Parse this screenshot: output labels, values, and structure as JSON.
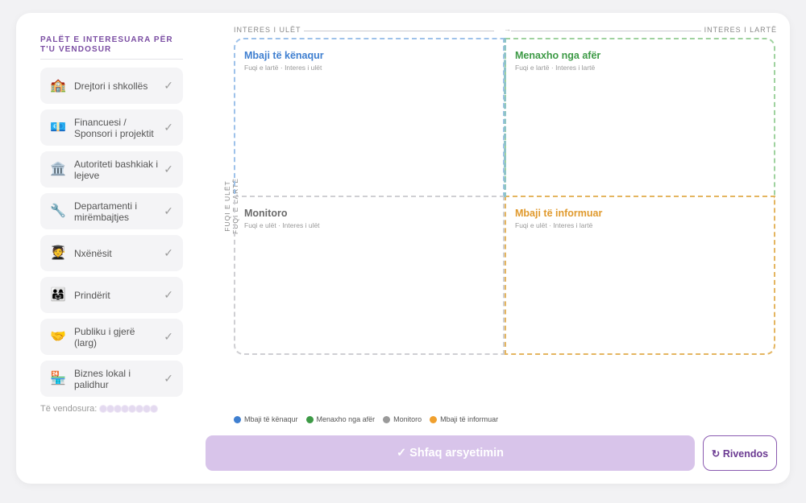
{
  "sidebar": {
    "title": "PALËT E INTERESUARA PËR T'U VENDOSUR",
    "items": [
      {
        "icon": "🏫",
        "icon_name": "school-icon",
        "label": "Drejtori i shkollës",
        "check": "✓"
      },
      {
        "icon": "💶",
        "icon_name": "money-icon",
        "label": "Financuesi / Sponsori i projektit",
        "check": "✓"
      },
      {
        "icon": "🏛️",
        "icon_name": "government-building-icon",
        "label": "Autoriteti bashkiak i lejeve",
        "check": "✓"
      },
      {
        "icon": "🔧",
        "icon_name": "wrench-icon",
        "label": "Departamenti i mirëmbajtjes",
        "check": "✓"
      },
      {
        "icon": "🧑‍🎓",
        "icon_name": "student-icon",
        "label": "Nxënësit",
        "check": "✓"
      },
      {
        "icon": "👨‍👩‍👧",
        "icon_name": "family-icon",
        "label": "Prindërit",
        "check": "✓"
      },
      {
        "icon": "🤝",
        "icon_name": "handshake-icon",
        "label": "Publiku i gjerë (larg)",
        "check": "✓"
      },
      {
        "icon": "🏪",
        "icon_name": "store-icon",
        "label": "Biznes lokal i palidhur",
        "check": "✓"
      }
    ],
    "decided_label": "Të vendosura:",
    "decided_count": 8
  },
  "axes": {
    "x_low": "INTERES I ULËT",
    "x_high": "INTERES I LARTË",
    "y_low": "FUQI E ULËT",
    "y_high": "FUQI E LARTË",
    "arrow": "→"
  },
  "quadrants": {
    "top_left": {
      "title": "Mbaji të kënaqur",
      "subtitle": "Fuqi e lartë · Interes i ulët",
      "color": "#3f7fd0"
    },
    "top_right": {
      "title": "Menaxho nga afër",
      "subtitle": "Fuqi e lartë · Interes i lartë",
      "color": "#3d9a46"
    },
    "bottom_left": {
      "title": "Monitoro",
      "subtitle": "Fuqi e ulët · Interes i ulët",
      "color": "#6a6a6a"
    },
    "bottom_right": {
      "title": "Mbaji të informuar",
      "subtitle": "Fuqi e ulët · Interes i lartë",
      "color": "#e09a2e"
    }
  },
  "legend": [
    {
      "label": "Mbaji të kënaqur",
      "color": "#3f7fd0"
    },
    {
      "label": "Menaxho nga afër",
      "color": "#3d9a46"
    },
    {
      "label": "Monitoro",
      "color": "#9a9a9a"
    },
    {
      "label": "Mbaji të informuar",
      "color": "#f0a02e"
    }
  ],
  "buttons": {
    "reasoning": "✓ Shfaq arsyetimin",
    "reset": "↻ Rivendos"
  }
}
